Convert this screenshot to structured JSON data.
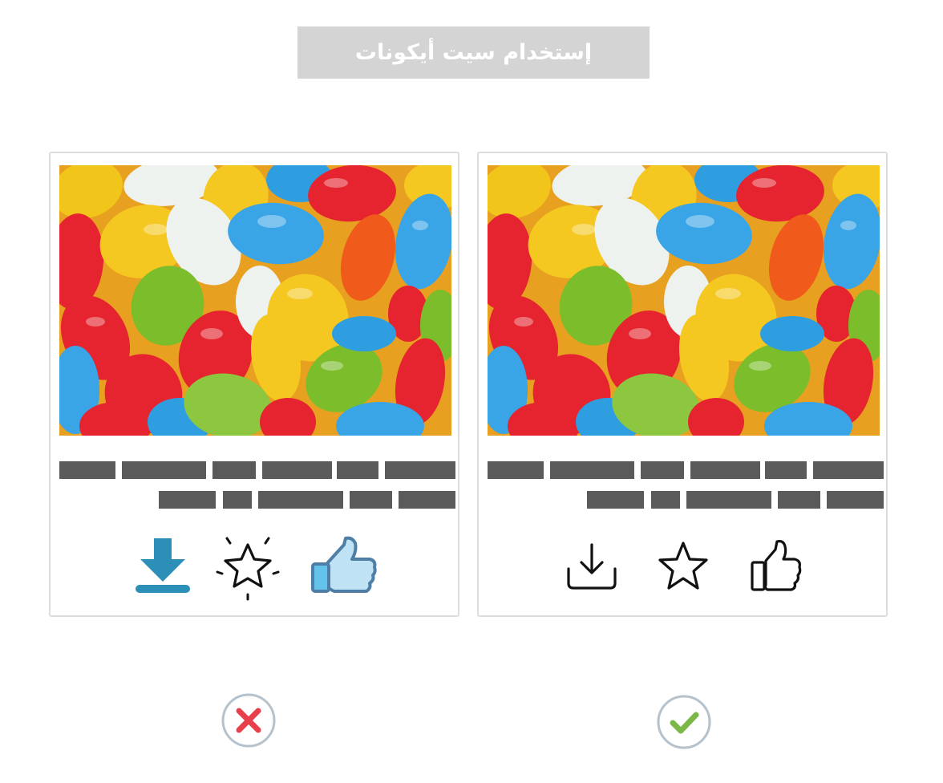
{
  "title": "إستخدام سيت أيكونات",
  "cards": [
    {
      "verdict": "incorrect",
      "icons": [
        "download-icon-filled-blue",
        "star-icon-sparkle-outline",
        "thumbs-up-icon-blue-filled"
      ]
    },
    {
      "verdict": "correct",
      "icons": [
        "download-icon-outline",
        "star-icon-outline",
        "thumbs-up-icon-outline"
      ]
    }
  ],
  "colors": {
    "banner_bg": "#d4d4d4",
    "placeholder_text": "#5a5a5a",
    "download_blue": "#2b8fb8",
    "thumb_blue": "#4f7fa6",
    "cross_red": "#e8404a",
    "check_green": "#7bb848",
    "badge_ring": "#b5c2cc"
  }
}
